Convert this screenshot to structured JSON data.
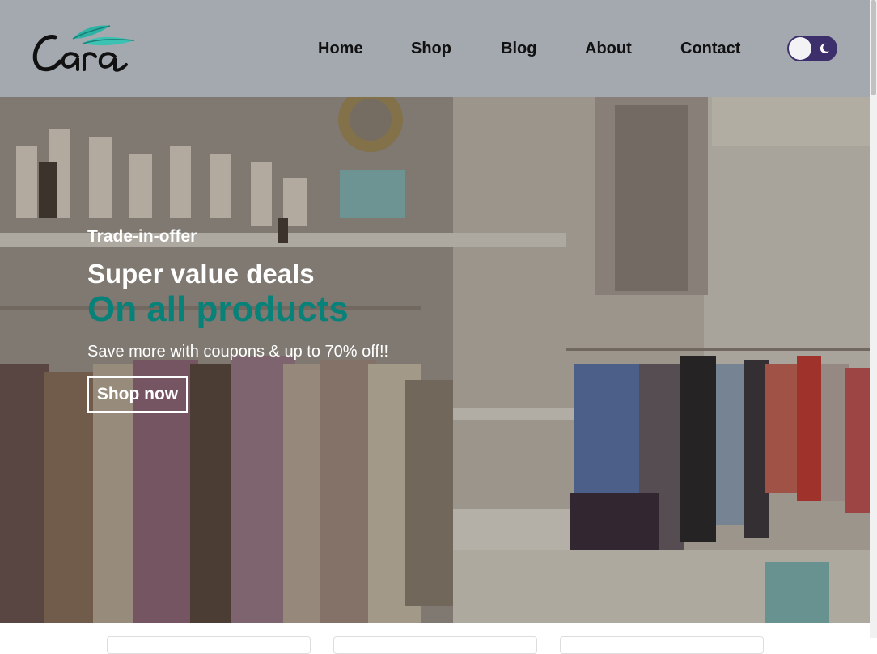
{
  "brand": {
    "logo_text": "Cara",
    "accent_color": "#088178"
  },
  "nav": {
    "items": [
      {
        "label": "Home"
      },
      {
        "label": "Shop"
      },
      {
        "label": "Blog"
      },
      {
        "label": "About"
      },
      {
        "label": "Contact"
      }
    ],
    "theme_toggle": {
      "icon": "moon-icon",
      "state": "dark"
    }
  },
  "hero": {
    "eyebrow": "Trade-in-offer",
    "headline": "Super value deals",
    "accent_line": "On all products",
    "subtext": "Save more with coupons & up to 70% off!!",
    "cta_label": "Shop now"
  },
  "colors": {
    "header_bg": "#a3a9ae",
    "toggle_bg": "#3d2f6b"
  }
}
